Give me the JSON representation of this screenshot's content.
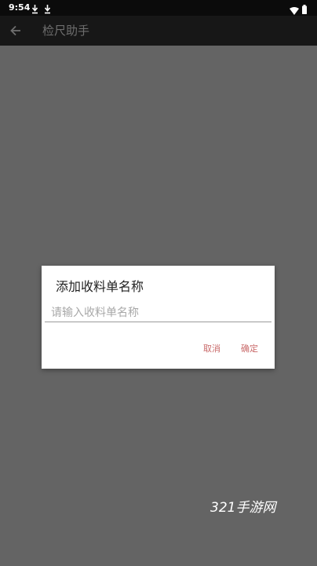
{
  "status_bar": {
    "time": "9:54",
    "icons": [
      "download-icon",
      "download-icon",
      "wifi-icon",
      "battery-icon"
    ]
  },
  "app_bar": {
    "back_icon": "arrow-left-icon",
    "title": "检尺助手"
  },
  "dialog": {
    "title": "添加收料单名称",
    "input_value": "",
    "input_placeholder": "请输入收料单名称",
    "cancel_label": "取消",
    "confirm_label": "确定"
  },
  "watermark": "321手游网",
  "colors": {
    "status_bar_bg": "#0b0b0b",
    "app_bar_bg": "#171717",
    "scrim": "#646464",
    "dialog_bg": "#ffffff",
    "button_text": "#c96a6a"
  }
}
